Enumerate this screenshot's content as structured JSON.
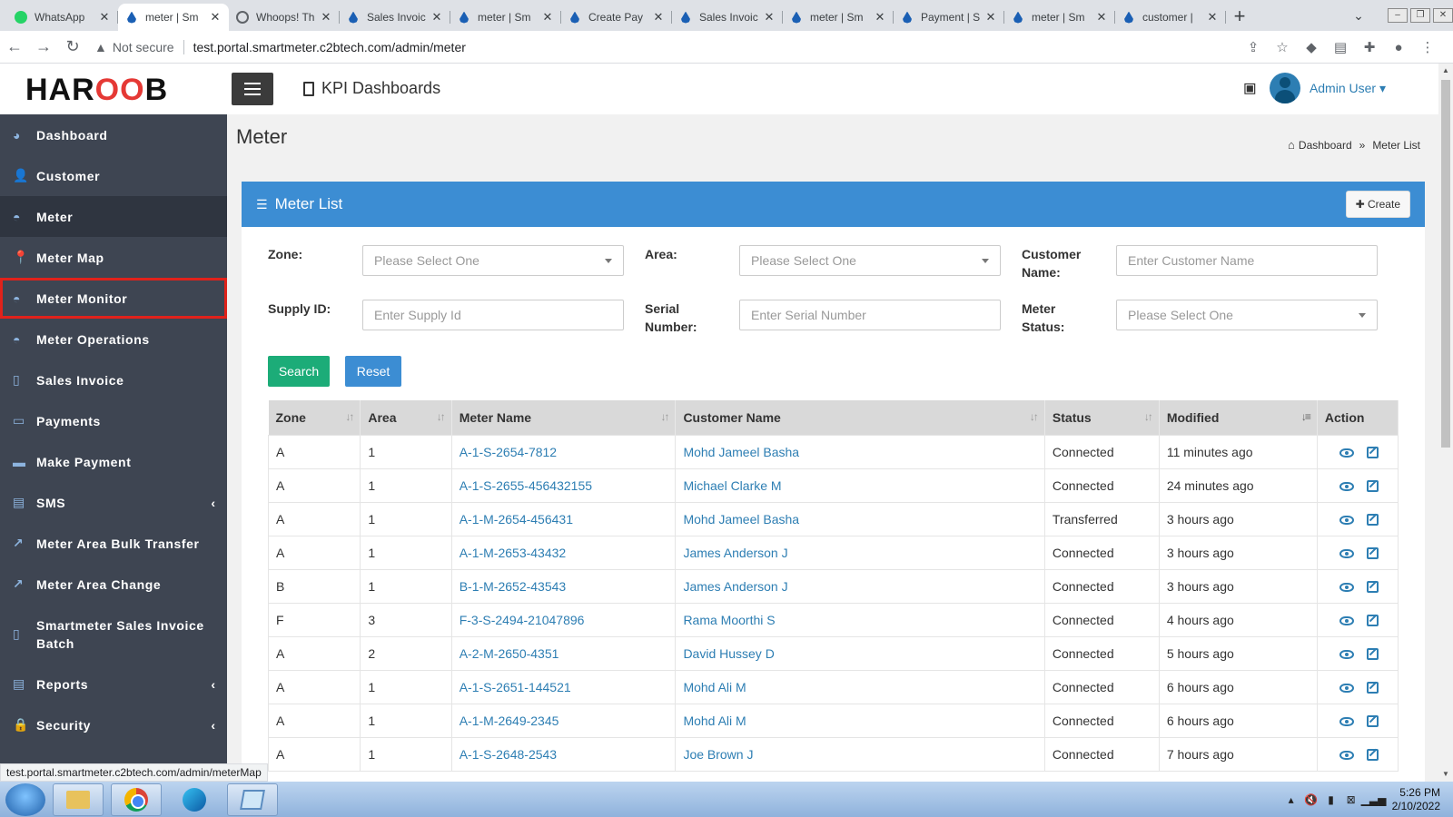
{
  "browser": {
    "tabs": [
      {
        "title": "WhatsApp",
        "icon": "whatsapp-icon",
        "active": false
      },
      {
        "title": "meter | Sm",
        "icon": "drop-icon",
        "active": true
      },
      {
        "title": "Whoops! Th",
        "icon": "globe-icon",
        "active": false
      },
      {
        "title": "Sales Invoic",
        "icon": "drop-icon",
        "active": false
      },
      {
        "title": "meter | Sm",
        "icon": "drop-icon",
        "active": false
      },
      {
        "title": "Create Pay",
        "icon": "drop-icon",
        "active": false
      },
      {
        "title": "Sales Invoic",
        "icon": "drop-icon",
        "active": false
      },
      {
        "title": "meter | Sm",
        "icon": "drop-icon",
        "active": false
      },
      {
        "title": "Payment | S",
        "icon": "drop-icon",
        "active": false
      },
      {
        "title": "meter | Sm",
        "icon": "drop-icon",
        "active": false
      },
      {
        "title": "customer |",
        "icon": "drop-icon",
        "active": false
      }
    ],
    "not_secure": "Not secure",
    "url": "test.portal.smartmeter.c2btech.com/admin/meter",
    "status_url": "test.portal.smartmeter.c2btech.com/admin/meterMap"
  },
  "header": {
    "logo_left": "HAR",
    "logo_mid": "OO",
    "logo_right": "B",
    "kpi_label": "KPI Dashboards",
    "user_name": "Admin User",
    "user_caret": "▾"
  },
  "sidebar": {
    "items": [
      {
        "label": "Dashboard",
        "icon": "pie-chart-icon",
        "glyph": "◕"
      },
      {
        "label": "Customer",
        "icon": "user-icon",
        "glyph": "👤"
      },
      {
        "label": "Meter",
        "icon": "gauge-icon",
        "glyph": "◓"
      },
      {
        "label": "Meter Map",
        "icon": "map-pin-icon",
        "glyph": "📍"
      },
      {
        "label": "Meter Monitor",
        "icon": "gauge-icon",
        "glyph": "◓"
      },
      {
        "label": "Meter Operations",
        "icon": "gauge-icon",
        "glyph": "◓"
      },
      {
        "label": "Sales Invoice",
        "icon": "file-icon",
        "glyph": "▯"
      },
      {
        "label": "Payments",
        "icon": "money-icon",
        "glyph": "▭"
      },
      {
        "label": "Make Payment",
        "icon": "credit-card-icon",
        "glyph": "▬"
      },
      {
        "label": "SMS",
        "icon": "sms-icon",
        "glyph": "▤",
        "arrow": "‹"
      },
      {
        "label": "Meter Area Bulk Transfer",
        "icon": "external-link-icon",
        "glyph": "↗"
      },
      {
        "label": "Meter Area Change",
        "icon": "external-link-icon",
        "glyph": "↗"
      },
      {
        "label": "Smartmeter Sales Invoice Batch",
        "icon": "file-icon",
        "glyph": "▯"
      },
      {
        "label": "Reports",
        "icon": "report-icon",
        "glyph": "▤",
        "arrow": "‹"
      },
      {
        "label": "Security",
        "icon": "lock-icon",
        "glyph": "🔒",
        "arrow": "‹"
      }
    ]
  },
  "page": {
    "title": "Meter",
    "breadcrumb_home": "Dashboard",
    "breadcrumb_sep": "»",
    "breadcrumb_current": "Meter List"
  },
  "card": {
    "title": "Meter List",
    "create_label": "Create"
  },
  "filters": {
    "zone_label": "Zone:",
    "zone_value": "Please Select One",
    "area_label": "Area:",
    "area_value": "Please Select One",
    "customer_name_label": "Customer Name:",
    "customer_name_placeholder": "Enter Customer Name",
    "supply_id_label": "Supply ID:",
    "supply_id_placeholder": "Enter Supply Id",
    "serial_number_label": "Serial Number:",
    "serial_number_placeholder": "Enter Serial Number",
    "meter_status_label": "Meter Status:",
    "meter_status_value": "Please Select One",
    "search_label": "Search",
    "reset_label": "Reset"
  },
  "table": {
    "columns": [
      "Zone",
      "Area",
      "Meter Name",
      "Customer Name",
      "Status",
      "Modified",
      "Action"
    ],
    "rows": [
      {
        "zone": "A",
        "area": "1",
        "meter": "A-1-S-2654-7812",
        "customer": "Mohd Jameel Basha",
        "status": "Connected",
        "modified": "11 minutes ago"
      },
      {
        "zone": "A",
        "area": "1",
        "meter": "A-1-S-2655-456432155",
        "customer": "Michael Clarke M",
        "status": "Connected",
        "modified": "24 minutes ago"
      },
      {
        "zone": "A",
        "area": "1",
        "meter": "A-1-M-2654-456431",
        "customer": "Mohd Jameel Basha",
        "status": "Transferred",
        "modified": "3 hours ago"
      },
      {
        "zone": "A",
        "area": "1",
        "meter": "A-1-M-2653-43432",
        "customer": "James Anderson J",
        "status": "Connected",
        "modified": "3 hours ago"
      },
      {
        "zone": "B",
        "area": "1",
        "meter": "B-1-M-2652-43543",
        "customer": "James Anderson J",
        "status": "Connected",
        "modified": "3 hours ago"
      },
      {
        "zone": "F",
        "area": "3",
        "meter": "F-3-S-2494-21047896",
        "customer": "Rama Moorthi S",
        "status": "Connected",
        "modified": "4 hours ago"
      },
      {
        "zone": "A",
        "area": "2",
        "meter": "A-2-M-2650-4351",
        "customer": "David Hussey D",
        "status": "Connected",
        "modified": "5 hours ago"
      },
      {
        "zone": "A",
        "area": "1",
        "meter": "A-1-S-2651-144521",
        "customer": "Mohd Ali M",
        "status": "Connected",
        "modified": "6 hours ago"
      },
      {
        "zone": "A",
        "area": "1",
        "meter": "A-1-M-2649-2345",
        "customer": "Mohd Ali M",
        "status": "Connected",
        "modified": "6 hours ago"
      },
      {
        "zone": "A",
        "area": "1",
        "meter": "A-1-S-2648-2543",
        "customer": "Joe Brown J",
        "status": "Connected",
        "modified": "7 hours ago"
      }
    ]
  },
  "taskbar": {
    "time": "5:26 PM",
    "date": "2/10/2022"
  },
  "colors": {
    "sidebar_bg": "#3e4552",
    "card_header": "#3c8dd3",
    "search_button": "#1cac78",
    "link": "#2d7eb3",
    "highlight_border": "#e0221b"
  }
}
